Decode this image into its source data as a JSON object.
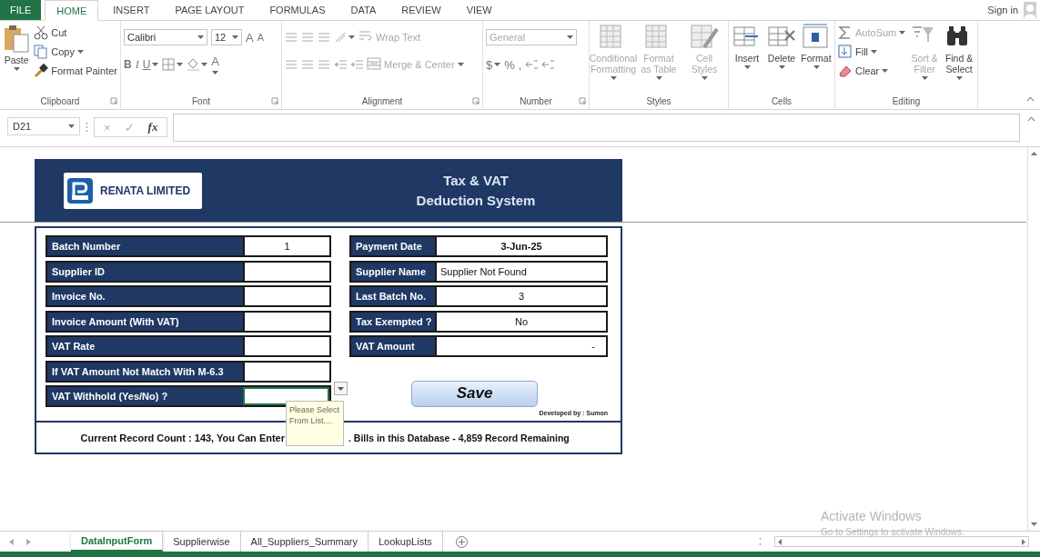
{
  "ribbon_tabs": [
    {
      "label": "FILE",
      "kind": "file",
      "selected": false
    },
    {
      "label": "HOME",
      "kind": "tab",
      "selected": true
    },
    {
      "label": "INSERT",
      "kind": "tab",
      "selected": false
    },
    {
      "label": "PAGE LAYOUT",
      "kind": "tab",
      "selected": false
    },
    {
      "label": "FORMULAS",
      "kind": "tab",
      "selected": false
    },
    {
      "label": "DATA",
      "kind": "tab",
      "selected": false
    },
    {
      "label": "REVIEW",
      "kind": "tab",
      "selected": false
    },
    {
      "label": "VIEW",
      "kind": "tab",
      "selected": false
    }
  ],
  "account": {
    "label": "Sign in"
  },
  "ribbon_groups": [
    {
      "kind": "clipboard",
      "name": "Clipboard",
      "paste": {
        "label": "Paste",
        "disabled": false
      },
      "cut": {
        "label": "Cut",
        "disabled": false
      },
      "copy": {
        "label": "Copy",
        "disabled": false
      },
      "format_painter": {
        "label": "Format Painter",
        "disabled": false
      }
    },
    {
      "kind": "font",
      "name": "Font",
      "font": "Calibri",
      "size": "12",
      "grow": "A",
      "shrink": "A",
      "bold": "B",
      "italic": "I",
      "underline": "U",
      "font_color": "A"
    },
    {
      "kind": "alignment",
      "name": "Alignment",
      "wrap_text": {
        "label": "Wrap Text",
        "disabled": true
      },
      "merge": {
        "label": "Merge & Center",
        "disabled": true
      }
    },
    {
      "kind": "number",
      "name": "Number",
      "format": {
        "label": "General",
        "disabled": true
      },
      "currency": "$",
      "percent": "%",
      "comma": ","
    },
    {
      "kind": "styles",
      "name": "Styles",
      "items": [
        {
          "label": "Conditional Formatting",
          "disabled": true
        },
        {
          "label": "Format as Table",
          "disabled": true
        },
        {
          "label": "Cell Styles",
          "disabled": true
        }
      ]
    },
    {
      "kind": "cells",
      "name": "Cells",
      "items": [
        {
          "label": "Insert",
          "disabled": false
        },
        {
          "label": "Delete",
          "disabled": false
        },
        {
          "label": "Format",
          "disabled": false
        }
      ]
    },
    {
      "kind": "editing",
      "name": "Editing",
      "small": [
        {
          "label": "AutoSum",
          "disabled": true
        },
        {
          "label": "Fill",
          "disabled": false
        },
        {
          "label": "Clear",
          "disabled": false
        }
      ],
      "large": [
        {
          "label": "Sort & Filter",
          "disabled": true
        },
        {
          "label": "Find & Select",
          "disabled": false
        }
      ]
    }
  ],
  "formula_bar": {
    "name_box": "D21",
    "cancel": "×",
    "enter": "✓",
    "function": "fx"
  },
  "form": {
    "company": "RENATA LIMITED",
    "title": [
      "Tax & VAT",
      "Deduction System"
    ],
    "left_fields": [
      {
        "label": "Batch Number",
        "value": "1",
        "kind": "number",
        "selected": false
      },
      {
        "label": "Supplier ID",
        "kind": "text",
        "selected": false
      },
      {
        "label": "Invoice No.",
        "kind": "text",
        "selected": false
      },
      {
        "label": "Invoice Amount (With VAT)",
        "kind": "text",
        "selected": false
      },
      {
        "label": "VAT Rate",
        "kind": "text",
        "selected": false
      },
      {
        "label": "If VAT Amount Not Match With M-6.3",
        "kind": "text",
        "selected": false
      },
      {
        "label": "VAT Withhold (Yes/No) ?",
        "kind": "text",
        "selected": true
      }
    ],
    "right_fields": [
      {
        "label": "Payment Date",
        "value": "3-Jun-25",
        "kind": "date",
        "selected": false
      },
      {
        "label": "Supplier Name",
        "value": "Supplier Not Found",
        "kind": "text",
        "selected": false
      },
      {
        "label": "Last Batch No.",
        "value": "3",
        "kind": "number",
        "selected": false
      },
      {
        "label": "Tax Exempted ?",
        "value": "No",
        "kind": "number",
        "selected": false
      },
      {
        "label": "VAT Amount",
        "value": "-",
        "kind": "accounting",
        "selected": false
      }
    ],
    "save_button": "Save",
    "credit": "Developed by : Sumon",
    "tooltip": "Please Select From List....",
    "footer": [
      "Current Record Count : 143, You Can Enter",
      ". Bills in this Database - 4,859 Record Remaining"
    ]
  },
  "sheet_tabs": [
    {
      "label": "DataInputForm",
      "selected": true
    },
    {
      "label": "Supplierwise",
      "selected": false
    },
    {
      "label": "All_Suppliers_Summary",
      "selected": false
    },
    {
      "label": "LookupLists",
      "selected": false
    }
  ],
  "system_notice": [
    "Activate Windows",
    "Go to Settings to activate Windows."
  ]
}
